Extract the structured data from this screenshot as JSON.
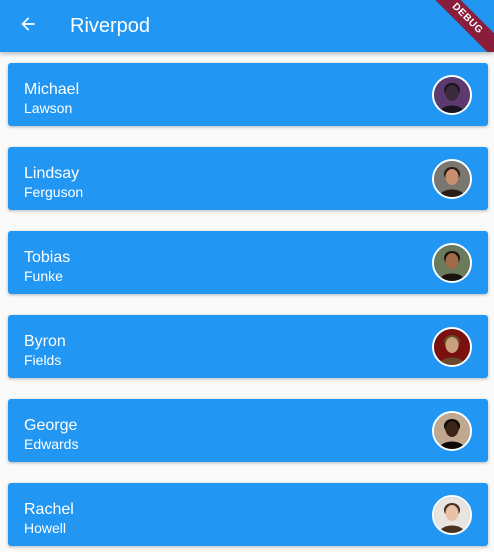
{
  "appbar": {
    "title": "Riverpod",
    "back_icon": "arrow-back-icon",
    "debug_banner": "DEBUG",
    "background": "#2196f3"
  },
  "people": [
    {
      "first": "Michael",
      "last": "Lawson",
      "avatar_bg": "#5c3a6e",
      "skin": "#3a2a3a",
      "hair": "#1a1420"
    },
    {
      "first": "Lindsay",
      "last": "Ferguson",
      "avatar_bg": "#7a7670",
      "skin": "#c89070",
      "hair": "#2a1d16"
    },
    {
      "first": "Tobias",
      "last": "Funke",
      "avatar_bg": "#6a7a5a",
      "skin": "#a06a48",
      "hair": "#1a120c"
    },
    {
      "first": "Byron",
      "last": "Fields",
      "avatar_bg": "#7a1010",
      "skin": "#c8a080",
      "hair": "#6a4a2a"
    },
    {
      "first": "George",
      "last": "Edwards",
      "avatar_bg": "#c0a890",
      "skin": "#3a2418",
      "hair": "#0e0a08"
    },
    {
      "first": "Rachel",
      "last": "Howell",
      "avatar_bg": "#e8e4e0",
      "skin": "#e8c0a8",
      "hair": "#4a3020"
    }
  ]
}
